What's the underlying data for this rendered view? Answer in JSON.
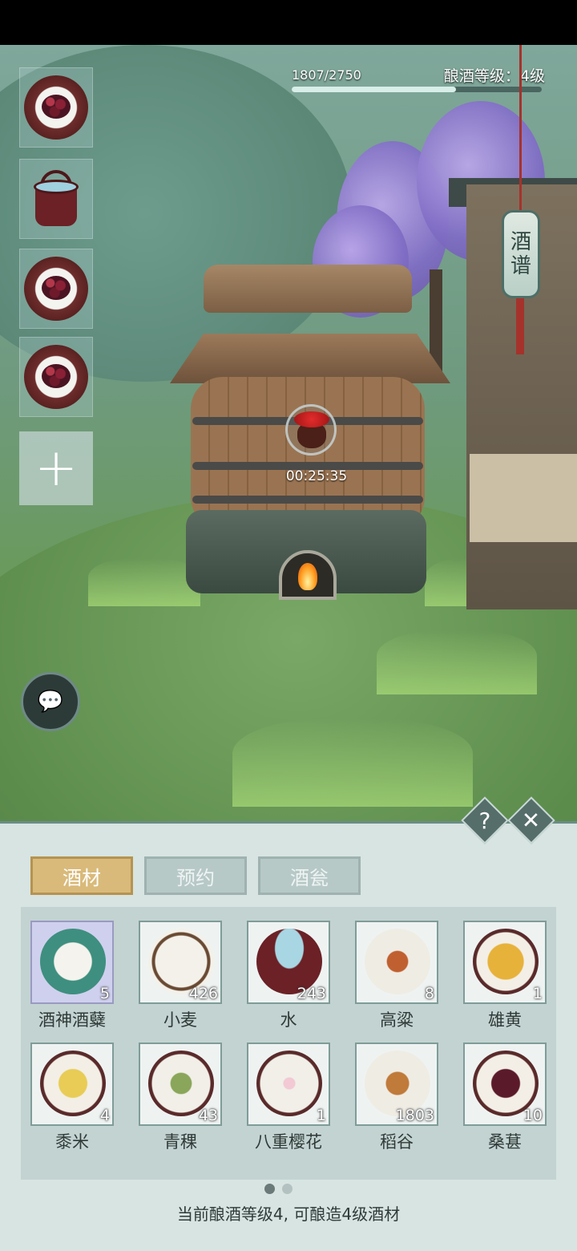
{
  "top_bar": {
    "xp_text": "1807/2750",
    "xp_fraction": 0.657,
    "level_text": "酿酒等级：4级"
  },
  "left_slots": [
    {
      "icon": "mulberry-icon"
    },
    {
      "icon": "water-bucket-icon"
    },
    {
      "icon": "mulberry-icon"
    },
    {
      "icon": "mulberry-icon"
    }
  ],
  "add_slot_icon": "+",
  "brewing": {
    "timer": "00:25:35",
    "icon": "wine-jar-icon"
  },
  "recipe_sign": {
    "line1": "酒",
    "line2": "谱"
  },
  "panel": {
    "help_label": "?",
    "close_label": "✕",
    "tabs": [
      {
        "label": "酒材",
        "active": true
      },
      {
        "label": "预约",
        "active": false
      },
      {
        "label": "酒瓮",
        "active": false
      }
    ],
    "items": [
      {
        "name": "酒神酒糵",
        "count": "5",
        "icon": "yeast-icon",
        "selected": true
      },
      {
        "name": "小麦",
        "count": "426",
        "icon": "wheat-icon",
        "selected": false
      },
      {
        "name": "水",
        "count": "243",
        "icon": "water-bucket-icon",
        "selected": false
      },
      {
        "name": "高粱",
        "count": "8",
        "icon": "sorghum-icon",
        "selected": false
      },
      {
        "name": "雄黄",
        "count": "1",
        "icon": "realgar-icon",
        "selected": false
      },
      {
        "name": "黍米",
        "count": "4",
        "icon": "millet-icon",
        "selected": false
      },
      {
        "name": "青稞",
        "count": "43",
        "icon": "highland-barley-icon",
        "selected": false
      },
      {
        "name": "八重樱花",
        "count": "1",
        "icon": "sakura-icon",
        "selected": false
      },
      {
        "name": "稻谷",
        "count": "1803",
        "icon": "rice-icon",
        "selected": false
      },
      {
        "name": "桑葚",
        "count": "10",
        "icon": "mulberry-icon",
        "selected": false
      }
    ],
    "page_count": 2,
    "current_page": 1,
    "footer": "当前酿酒等级4, 可酿造4级酒材"
  }
}
